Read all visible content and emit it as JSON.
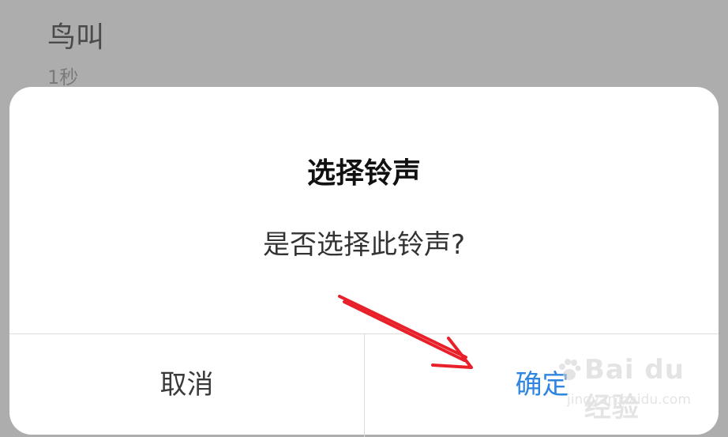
{
  "background_item": {
    "title": "鸟叫",
    "subtitle": "1秒"
  },
  "dialog": {
    "title": "选择铃声",
    "message": "是否选择此铃声?",
    "cancel_label": "取消",
    "confirm_label": "确定"
  },
  "colors": {
    "overlay": "#adadad",
    "dialog_bg": "#ffffff",
    "confirm_accent": "#2f86e0",
    "annotation": "#e8202a"
  },
  "watermark": {
    "brand": "Bai du 经验",
    "url": "jingyan.baidu.com"
  }
}
